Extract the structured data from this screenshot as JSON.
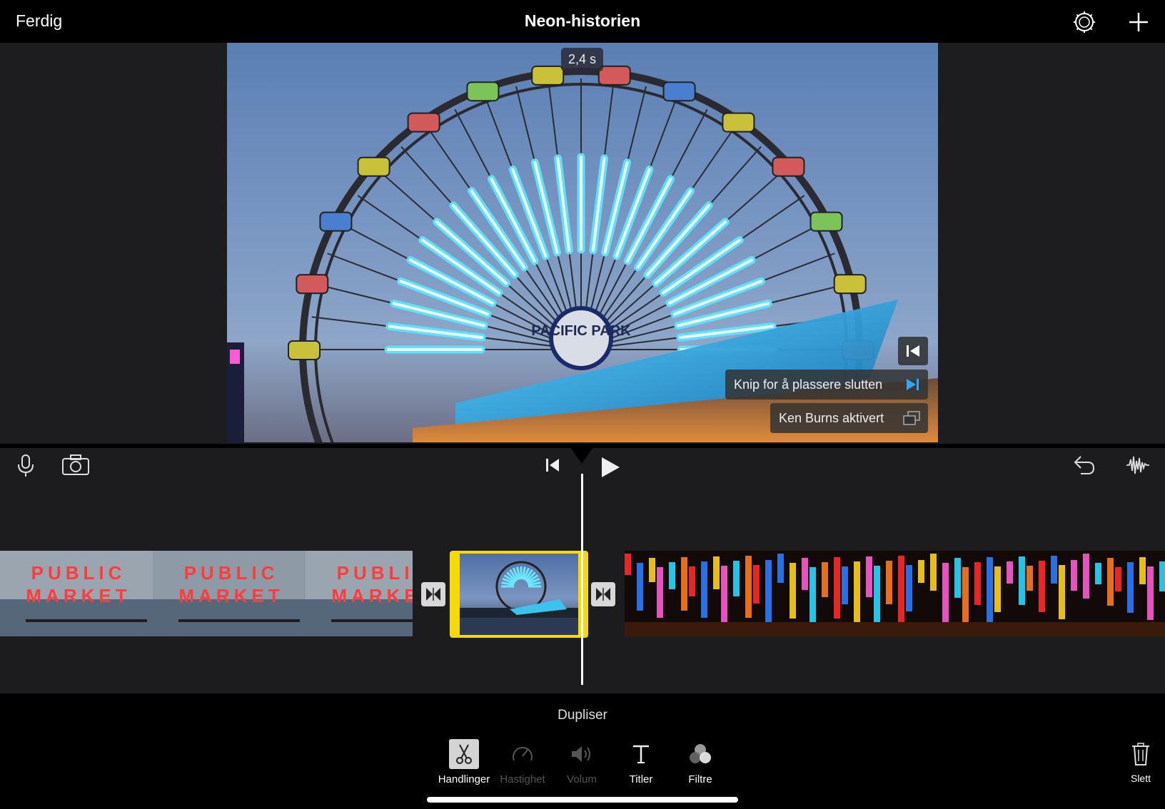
{
  "header": {
    "done_label": "Ferdig",
    "project_title": "Neon-historien",
    "settings_icon": "gear-icon",
    "add_icon": "plus-icon"
  },
  "viewer": {
    "duration": "2,4 s",
    "hint_trim_end": "Knip for å plassere slutten",
    "hint_ken_burns": "Ken Burns aktivert",
    "sign_text": "PACIFIC PARK"
  },
  "timeline": {
    "clips": [
      {
        "name": "public-market",
        "sign_line_1": "PUBLIC",
        "sign_line_2": "MARKET"
      },
      {
        "name": "ferris-wheel",
        "selected": true
      },
      {
        "name": "tokyo-neon-street"
      }
    ],
    "selection_color": "#f5d90a"
  },
  "toolbar": {
    "action_label": "Dupliser",
    "tools": [
      {
        "label": "Handlinger",
        "icon": "scissors-icon",
        "active": true
      },
      {
        "label": "Hastighet",
        "icon": "speedometer-icon",
        "enabled": false
      },
      {
        "label": "Volum",
        "icon": "speaker-icon",
        "enabled": false
      },
      {
        "label": "Titler",
        "icon": "text-icon",
        "enabled": true
      },
      {
        "label": "Filtre",
        "icon": "filters-icon",
        "enabled": true
      }
    ],
    "delete_label": "Slett"
  }
}
